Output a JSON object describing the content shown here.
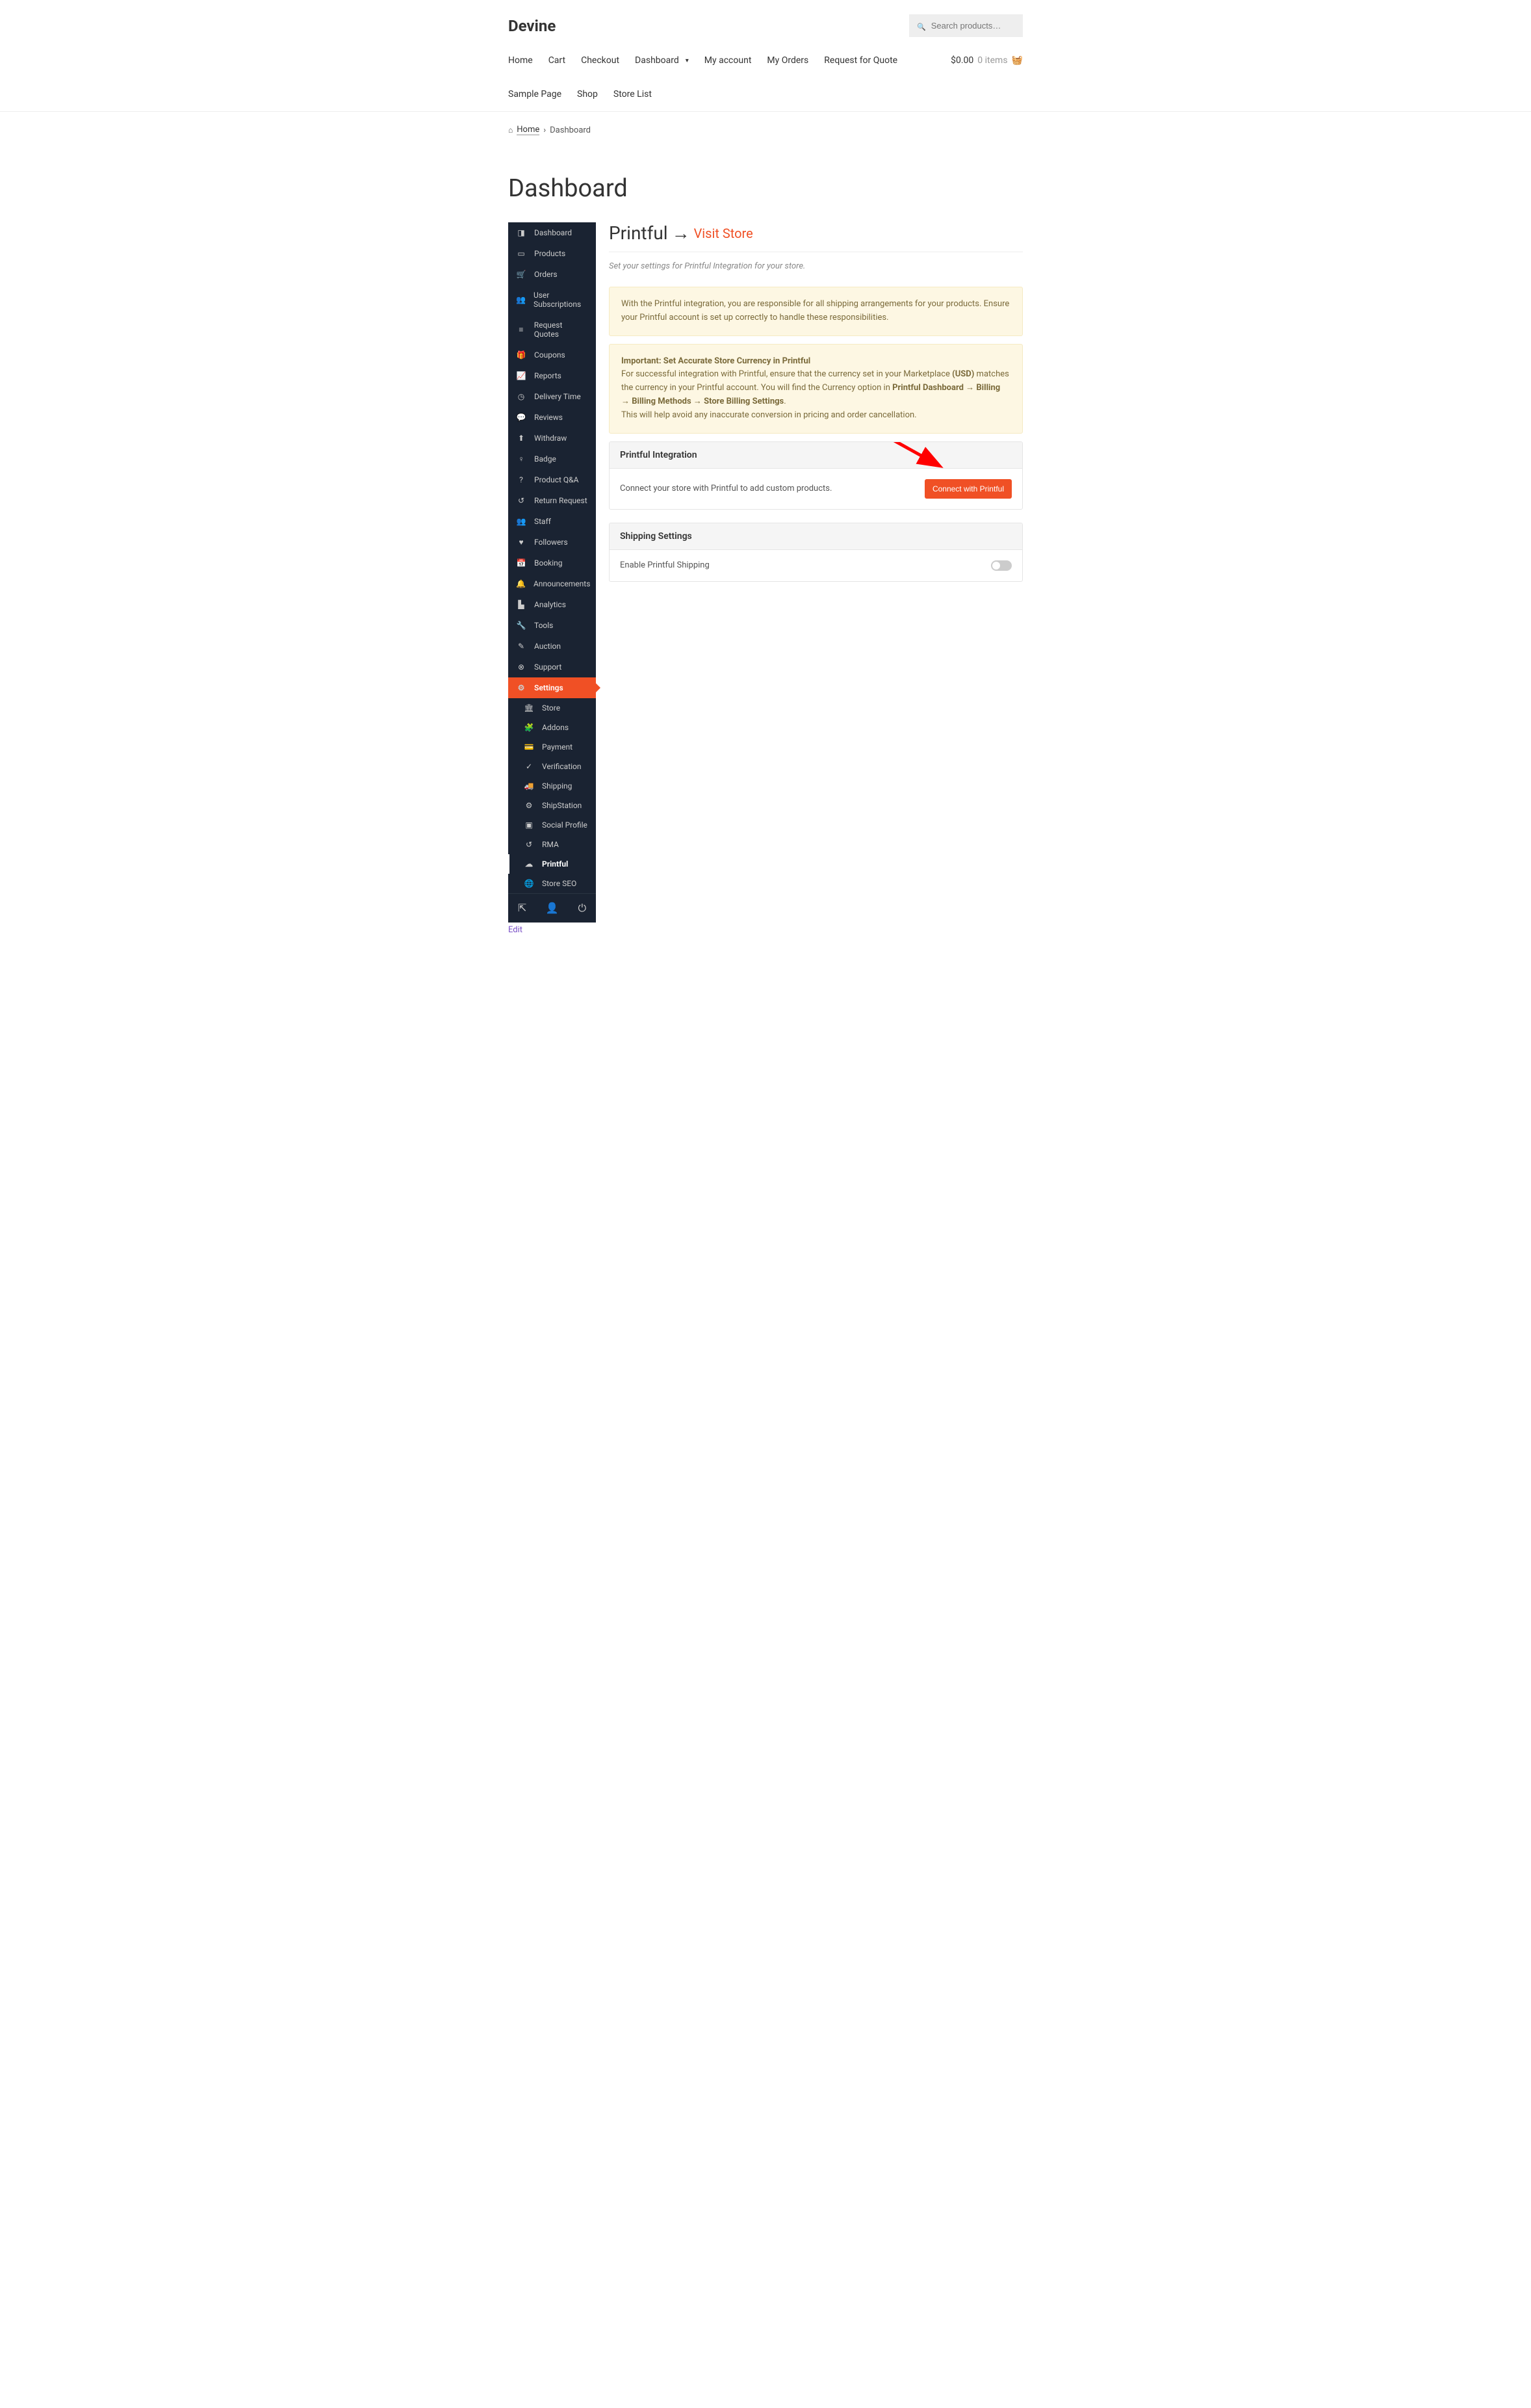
{
  "site": {
    "title": "Devine"
  },
  "search": {
    "placeholder": "Search products…"
  },
  "nav": {
    "items": [
      "Home",
      "Cart",
      "Checkout",
      "Dashboard",
      "My account",
      "My Orders",
      "Request for Quote",
      "Sample Page",
      "Shop",
      "Store List"
    ]
  },
  "cart": {
    "total": "$0.00",
    "items": "0 items"
  },
  "breadcrumb": {
    "home": "Home",
    "current": "Dashboard"
  },
  "page": {
    "title": "Dashboard"
  },
  "sidebar": {
    "items": [
      {
        "label": "Dashboard",
        "icon": "dashboard-icon"
      },
      {
        "label": "Products",
        "icon": "products-icon"
      },
      {
        "label": "Orders",
        "icon": "orders-icon"
      },
      {
        "label": "User Subscriptions",
        "icon": "subscriptions-icon"
      },
      {
        "label": "Request Quotes",
        "icon": "quotes-icon"
      },
      {
        "label": "Coupons",
        "icon": "coupons-icon"
      },
      {
        "label": "Reports",
        "icon": "reports-icon"
      },
      {
        "label": "Delivery Time",
        "icon": "clock-icon"
      },
      {
        "label": "Reviews",
        "icon": "reviews-icon"
      },
      {
        "label": "Withdraw",
        "icon": "withdraw-icon"
      },
      {
        "label": "Badge",
        "icon": "badge-icon"
      },
      {
        "label": "Product Q&A",
        "icon": "qa-icon"
      },
      {
        "label": "Return Request",
        "icon": "return-icon"
      },
      {
        "label": "Staff",
        "icon": "staff-icon"
      },
      {
        "label": "Followers",
        "icon": "followers-icon"
      },
      {
        "label": "Booking",
        "icon": "booking-icon"
      },
      {
        "label": "Announcements",
        "icon": "announcements-icon"
      },
      {
        "label": "Analytics",
        "icon": "analytics-icon"
      },
      {
        "label": "Tools",
        "icon": "tools-icon"
      },
      {
        "label": "Auction",
        "icon": "auction-icon"
      },
      {
        "label": "Support",
        "icon": "support-icon"
      },
      {
        "label": "Settings",
        "icon": "settings-icon"
      }
    ],
    "subitems": [
      {
        "label": "Store",
        "icon": "store-icon"
      },
      {
        "label": "Addons",
        "icon": "addons-icon"
      },
      {
        "label": "Payment",
        "icon": "payment-icon"
      },
      {
        "label": "Verification",
        "icon": "verification-icon"
      },
      {
        "label": "Shipping",
        "icon": "shipping-icon"
      },
      {
        "label": "ShipStation",
        "icon": "shipstation-icon"
      },
      {
        "label": "Social Profile",
        "icon": "social-icon"
      },
      {
        "label": "RMA",
        "icon": "rma-icon"
      },
      {
        "label": "Printful",
        "icon": "printful-icon"
      },
      {
        "label": "Store SEO",
        "icon": "seo-icon"
      }
    ]
  },
  "content": {
    "title": "Printful",
    "visit_store": "Visit Store",
    "subtitle": "Set your settings for Printful Integration for your store.",
    "callout1": "With the Printful integration, you are responsible for all shipping arrangements for your products. Ensure your Printful account is set up correctly to handle these responsibilities.",
    "callout2_title": "Important: Set Accurate Store Currency in Printful",
    "callout2_p1a": "For successful integration with Printful, ensure that the currency set in your Marketplace ",
    "callout2_usd": "(USD)",
    "callout2_p1b": " matches the currency in your Printful account. You will find the Currency option in ",
    "callout2_path": "Printful Dashboard → Billing → Billing Methods → Store Billing Settings",
    "callout2_p2": "This will help avoid any inaccurate conversion in pricing and order cancellation.",
    "panel1_header": "Printful Integration",
    "panel1_body": "Connect your store with Printful to add custom products.",
    "connect_btn": "Connect with Printful",
    "panel2_header": "Shipping Settings",
    "panel2_body": "Enable Printful Shipping"
  },
  "footer": {
    "edit": "Edit"
  }
}
